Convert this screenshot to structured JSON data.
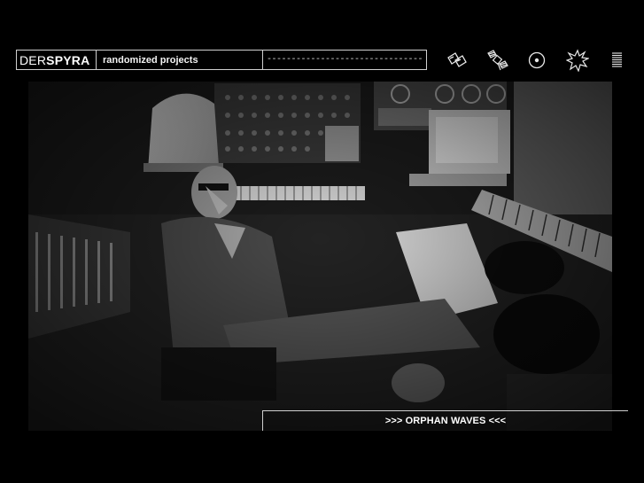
{
  "header": {
    "logo_prefix": "DER",
    "logo_main": "SPYRA",
    "tagline": "randomized projects",
    "search_placeholder": "--------------------------------"
  },
  "nav": [
    {
      "name": "sampler-icon"
    },
    {
      "name": "satellite-icon"
    },
    {
      "name": "disc-icon"
    },
    {
      "name": "starburst-icon"
    },
    {
      "name": "menu-icon"
    }
  ],
  "photo": {
    "caption": ">>> ORPHAN WAVES <<<"
  },
  "colors": {
    "background": "#000000",
    "border": "#cfcfcf",
    "text": "#ffffff"
  }
}
